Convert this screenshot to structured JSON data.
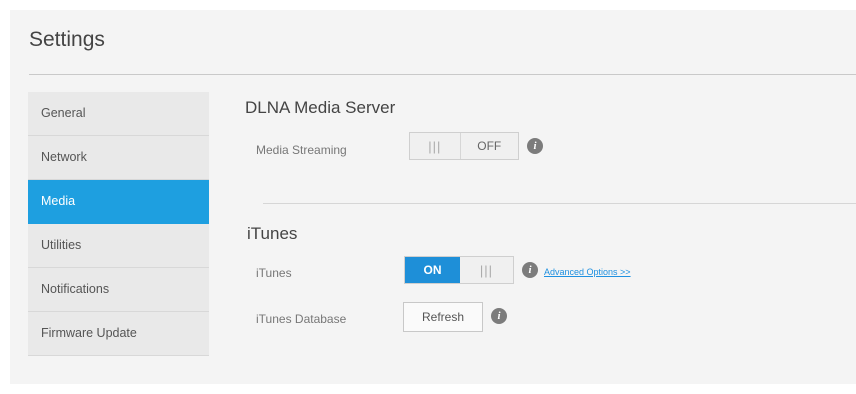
{
  "header": {
    "title": "Settings"
  },
  "sidebar": {
    "items": [
      {
        "label": "General",
        "active": false
      },
      {
        "label": "Network",
        "active": false
      },
      {
        "label": "Media",
        "active": true
      },
      {
        "label": "Utilities",
        "active": false
      },
      {
        "label": "Notifications",
        "active": false
      },
      {
        "label": "Firmware Update",
        "active": false
      }
    ]
  },
  "dlna": {
    "title": "DLNA Media Server",
    "media_streaming": {
      "label": "Media Streaming",
      "state_label": "OFF",
      "enabled": false
    }
  },
  "itunes": {
    "title": "iTunes",
    "itunes_toggle": {
      "label": "iTunes",
      "state_label": "ON",
      "enabled": true
    },
    "advanced_link": "Advanced Options >>",
    "database": {
      "label": "iTunes Database",
      "button_label": "Refresh"
    }
  },
  "colors": {
    "accent": "#1e9fe0",
    "toggle_on": "#1e8fd8"
  },
  "icons": {
    "info": "info-icon",
    "grip": "grip-icon"
  }
}
